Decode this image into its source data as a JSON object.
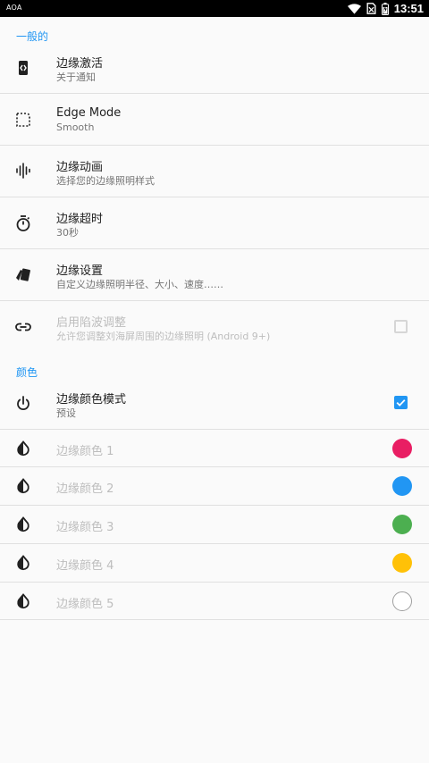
{
  "status_bar": {
    "app_label": "AOA",
    "time": "13:51"
  },
  "sections": {
    "general": "一般的",
    "colors": "颜色"
  },
  "settings": [
    {
      "title": "边缘激活",
      "subtitle": "关于通知",
      "icon": "edge-activation-icon"
    },
    {
      "title": "Edge Mode",
      "subtitle": "Smooth",
      "icon": "corner-frame-icon"
    },
    {
      "title": "边缘动画",
      "subtitle": "选择您的边缘照明样式",
      "icon": "waveform-icon"
    },
    {
      "title": "边缘超时",
      "subtitle": "30秒",
      "icon": "timer-icon"
    },
    {
      "title": "边缘设置",
      "subtitle": "自定义边缘照明半径、大小、速度……",
      "icon": "cards-icon"
    },
    {
      "title": "启用陷波调整",
      "subtitle": "允许您调整刘海屏周围的边缘照明 (Android 9+)",
      "icon": "link-icon",
      "checked": false
    }
  ],
  "color_mode": {
    "title": "边缘颜色模式",
    "subtitle": "预设",
    "icon": "power-icon",
    "checked": true
  },
  "edge_colors": [
    {
      "label": "边缘颜色 1",
      "color": "#e91e63"
    },
    {
      "label": "边缘颜色 2",
      "color": "#2196f3"
    },
    {
      "label": "边缘颜色 3",
      "color": "#4caf50"
    },
    {
      "label": "边缘颜色 4",
      "color": "#ffc107"
    },
    {
      "label": "边缘颜色 5",
      "color": "#ffffff"
    }
  ],
  "theme": {
    "accent": "#2196f3",
    "divider": "#e0e0e0"
  }
}
